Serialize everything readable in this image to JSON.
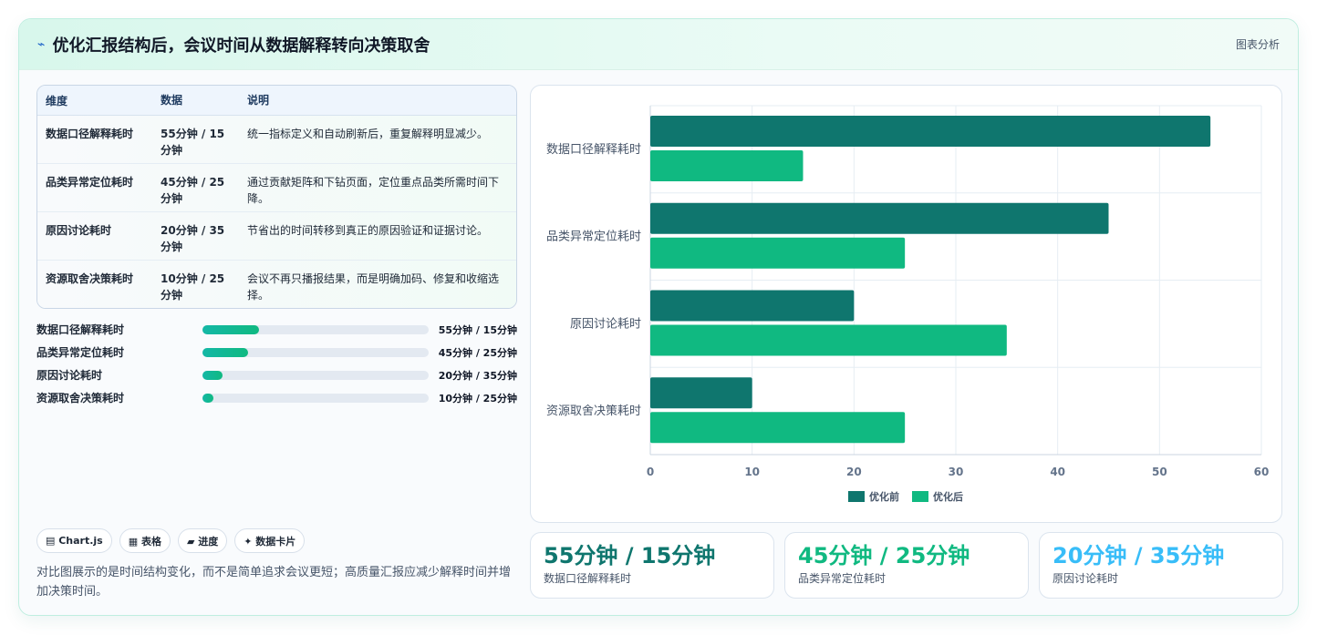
{
  "header": {
    "title": "优化汇报结构后，会议时间从数据解释转向决策取舍",
    "link": "图表分析"
  },
  "table": {
    "headers": [
      "维度",
      "数据",
      "说明"
    ],
    "rows": [
      {
        "dim": "数据口径解释耗时",
        "data": "55分钟 / 15分钟",
        "desc": "统一指标定义和自动刷新后，重复解释明显减少。"
      },
      {
        "dim": "品类异常定位耗时",
        "data": "45分钟 / 25分钟",
        "desc": "通过贡献矩阵和下钻页面，定位重点品类所需时间下降。"
      },
      {
        "dim": "原因讨论耗时",
        "data": "20分钟 / 35分钟",
        "desc": "节省出的时间转移到真正的原因验证和证据讨论。"
      },
      {
        "dim": "资源取舍决策耗时",
        "data": "10分钟 / 25分钟",
        "desc": "会议不再只播报结果，而是明确加码、修复和收缩选择。"
      }
    ]
  },
  "progress": [
    {
      "label": "数据口径解释耗时",
      "value": "55分钟 / 15分钟",
      "ratio": 0.25
    },
    {
      "label": "品类异常定位耗时",
      "value": "45分钟 / 25分钟",
      "ratio": 0.2
    },
    {
      "label": "原因讨论耗时",
      "value": "20分钟 / 35分钟",
      "ratio": 0.09
    },
    {
      "label": "资源取舍决策耗时",
      "value": "10分钟 / 25分钟",
      "ratio": 0.05
    }
  ],
  "chips": [
    "▤ Chart.js",
    "▦ 表格",
    "▰ 进度",
    "✦ 数据卡片"
  ],
  "note": "对比图展示的是时间结构变化，而不是简单追求会议更短；高质量汇报应减少解释时间并增加决策时间。",
  "stats": [
    {
      "value": "55分钟 / 15分钟",
      "label": "数据口径解释耗时",
      "color": "#0f766e"
    },
    {
      "value": "45分钟 / 25分钟",
      "label": "品类异常定位耗时",
      "color": "#10b981"
    },
    {
      "value": "20分钟 / 35分钟",
      "label": "原因讨论耗时",
      "color": "#38bdf8"
    }
  ],
  "colors": {
    "before": "#0f766e",
    "after": "#10b981"
  },
  "chart_data": {
    "type": "bar",
    "orientation": "horizontal",
    "categories": [
      "数据口径解释耗时",
      "品类异常定位耗时",
      "原因讨论耗时",
      "资源取舍决策耗时"
    ],
    "series": [
      {
        "name": "优化前",
        "values": [
          55,
          45,
          20,
          10
        ]
      },
      {
        "name": "优化后",
        "values": [
          15,
          25,
          35,
          25
        ]
      }
    ],
    "xlim": [
      0,
      60
    ],
    "xticks": [
      0,
      10,
      20,
      30,
      40,
      50,
      60
    ],
    "grid": true,
    "legend": "bottom"
  }
}
